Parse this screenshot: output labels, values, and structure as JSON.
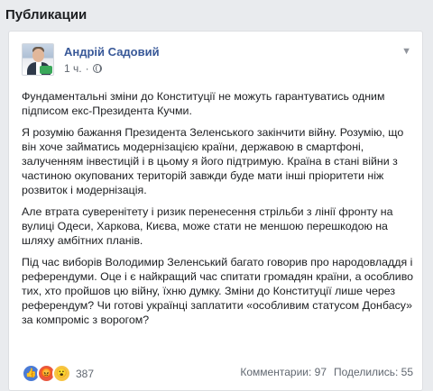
{
  "section": {
    "title": "Публикации"
  },
  "post": {
    "author": "Андрій Садовий",
    "time": "1 ч.",
    "dot": "·",
    "paragraphs": [
      "Фундаментальні зміни до Конституції не можуть гарантуватись одним підписом екс-Президента Кучми.",
      "Я розумію бажання Президента Зеленського закінчити війну. Розумію, що він хоче займатись модернізацією країни, державою в смартфоні, залученням інвестицій і в цьому я його підтримую. Країна в стані війни з частиною окупованих територій завжди буде мати інші пріоритети ніж розвиток і модернізація.",
      "Але втрата суверенітету і ризик перенесення стрільби з лінії фронту на вулиці Одеси, Харкова, Києва, може стати не меншою перешкодою на шляху амбітних планів.",
      "Під час виборів Володимир Зеленський багато говорив про народовладдя і референдуми. Оце і є найкращий час спитати громадян країни, а особливо тих, хто пройшов цю війну, їхню думку. Зміни до Конституції лише через референдум? Чи готові українці заплатити «особливим статусом Донбасу» за компроміс з ворогом?"
    ],
    "reactions": {
      "icons": [
        "like-icon",
        "angry-icon",
        "wow-icon"
      ],
      "like_glyph": "👍",
      "angry_glyph": "😡",
      "wow_glyph": "😮",
      "count": "387"
    },
    "comments": "Комментарии: 97",
    "shares": "Поделились: 55"
  },
  "colors": {
    "author_link": "#385898",
    "background": "#e9ebee",
    "card": "#ffffff"
  }
}
